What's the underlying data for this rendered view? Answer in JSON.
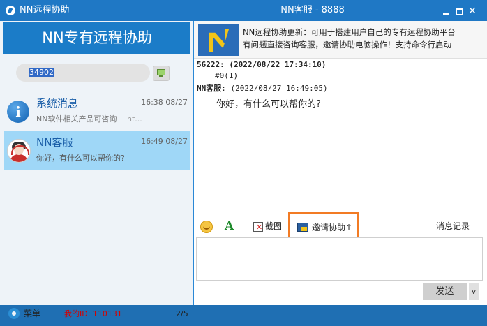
{
  "window": {
    "app_title": "NN远程协助",
    "chat_title": "NN客服 - 8888",
    "close_glyph": "✕"
  },
  "sidebar": {
    "banner": "NN专有远程协助",
    "id_value": "34902",
    "conversations": [
      {
        "name": "系统消息",
        "time": "16:38 08/27",
        "preview": "NN软件相关产品可咨询",
        "preview_suffix": "ht..."
      },
      {
        "name": "NN客服",
        "time": "16:49 08/27",
        "preview": "你好，有什么可以帮你的?"
      }
    ],
    "menu_label": "菜单",
    "my_id": "我的ID: 110131",
    "page_indicator": "2/5"
  },
  "notice": {
    "line1": "NN远程协助更新：可用于搭建用户自己的专有远程协助平台",
    "line2": "有问题直接咨询客服，邀请协助电脑操作！支持命令行启动"
  },
  "messages": [
    {
      "sender": "56222: (2022/08/22 17:34:10)",
      "body": "#0(1)"
    },
    {
      "sender_name": "NN客服",
      "sender_time": ": (2022/08/27 16:49:05)",
      "body": "你好，有什么可以帮你的?"
    }
  ],
  "toolbar": {
    "screenshot_label": "截图",
    "invite_label": "邀请协助",
    "invite_arrow": "↑",
    "history_label": "消息记录",
    "font_glyph": "A"
  },
  "compose": {
    "send_label": "发送",
    "send_dropdown_glyph": "v"
  },
  "colors": {
    "title_bar": "#1f78c5",
    "banner": "#1b7cc8",
    "selected_row": "#9fd7f7",
    "highlight_box": "#f27b24",
    "my_id_text": "#d40000"
  }
}
